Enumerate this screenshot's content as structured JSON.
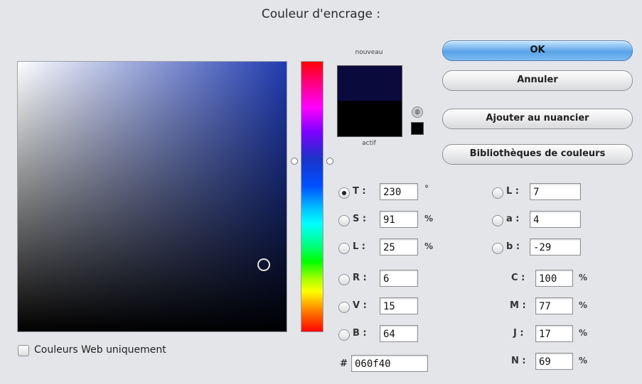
{
  "dialog": {
    "title": "Couleur d'encrage :"
  },
  "swatches": {
    "new_label": "nouveau",
    "current_label": "actif",
    "new_color": "#0b0a3c",
    "current_color": "#000000"
  },
  "buttons": {
    "ok": "OK",
    "cancel": "Annuler",
    "add_to_swatches": "Ajouter au nuancier",
    "color_libraries": "Bibliothèques de couleurs"
  },
  "hsb": [
    {
      "label": "T :",
      "value": "230",
      "unit": "°",
      "selected": true
    },
    {
      "label": "S :",
      "value": "91",
      "unit": "%",
      "selected": false
    },
    {
      "label": "L :",
      "value": "25",
      "unit": "%",
      "selected": false
    }
  ],
  "rgb": [
    {
      "label": "R :",
      "value": "6"
    },
    {
      "label": "V :",
      "value": "15"
    },
    {
      "label": "B :",
      "value": "64"
    }
  ],
  "lab": [
    {
      "label": "L :",
      "value": "7"
    },
    {
      "label": "a :",
      "value": "4"
    },
    {
      "label": "b :",
      "value": "-29"
    }
  ],
  "cmyk": [
    {
      "label": "C :",
      "value": "100",
      "unit": "%"
    },
    {
      "label": "M :",
      "value": "77",
      "unit": "%"
    },
    {
      "label": "J :",
      "value": "17",
      "unit": "%"
    },
    {
      "label": "N :",
      "value": "69",
      "unit": "%"
    }
  ],
  "hex": {
    "label": "#",
    "value": "060f40"
  },
  "web_only": {
    "label": "Couleurs Web uniquement",
    "checked": false
  },
  "colors": {
    "accent": "#5aa3e8",
    "background": "#e4e5e8"
  }
}
